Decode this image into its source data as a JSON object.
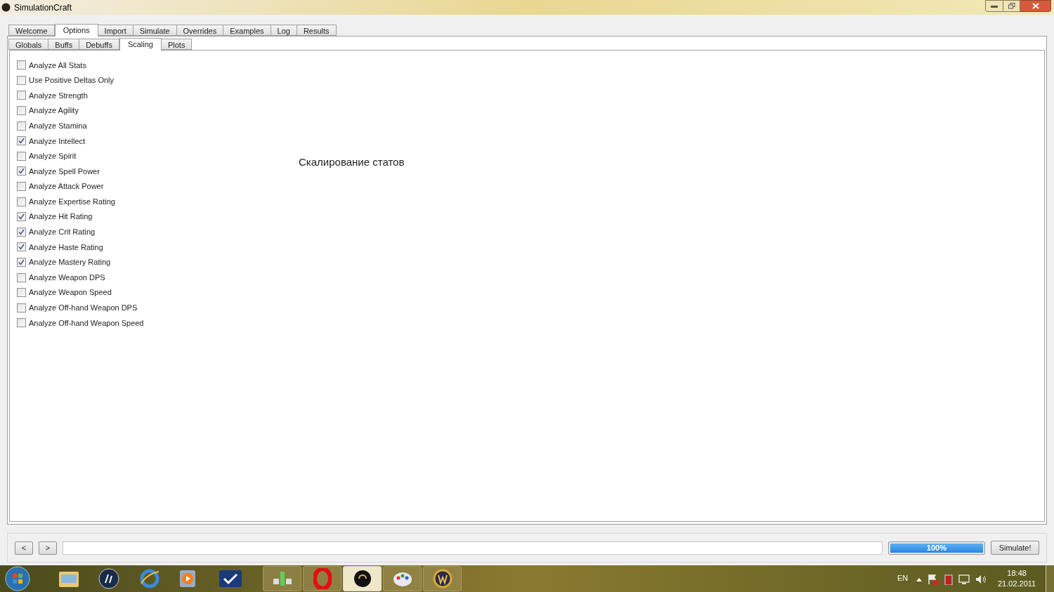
{
  "window": {
    "title": "SimulationCraft"
  },
  "tabs": [
    {
      "label": "Welcome",
      "selected": false
    },
    {
      "label": "Options",
      "selected": true
    },
    {
      "label": "Import",
      "selected": false
    },
    {
      "label": "Simulate",
      "selected": false
    },
    {
      "label": "Overrides",
      "selected": false
    },
    {
      "label": "Examples",
      "selected": false
    },
    {
      "label": "Log",
      "selected": false
    },
    {
      "label": "Results",
      "selected": false
    }
  ],
  "subtabs": [
    {
      "label": "Globals",
      "selected": false
    },
    {
      "label": "Buffs",
      "selected": false
    },
    {
      "label": "Debuffs",
      "selected": false
    },
    {
      "label": "Scaling",
      "selected": true
    },
    {
      "label": "Plots",
      "selected": false
    }
  ],
  "options": [
    {
      "label": "Analyze All Stats",
      "checked": false
    },
    {
      "label": "Use Positive Deltas Only",
      "checked": false
    },
    {
      "label": "Analyze Strength",
      "checked": false
    },
    {
      "label": "Analyze Agility",
      "checked": false
    },
    {
      "label": "Analyze Stamina",
      "checked": false
    },
    {
      "label": "Analyze Intellect",
      "checked": true
    },
    {
      "label": "Analyze Spirit",
      "checked": false
    },
    {
      "label": "Analyze Spell Power",
      "checked": true
    },
    {
      "label": "Analyze Attack Power",
      "checked": false
    },
    {
      "label": "Analyze Expertise Rating",
      "checked": false
    },
    {
      "label": "Analyze Hit Rating",
      "checked": true
    },
    {
      "label": "Analyze Crit Rating",
      "checked": true
    },
    {
      "label": "Analyze Haste Rating",
      "checked": true
    },
    {
      "label": "Analyze Mastery Rating",
      "checked": true
    },
    {
      "label": "Analyze Weapon DPS",
      "checked": false
    },
    {
      "label": "Analyze Weapon Speed",
      "checked": false
    },
    {
      "label": "Analyze Off-hand Weapon DPS",
      "checked": false
    },
    {
      "label": "Analyze Off-hand Weapon Speed",
      "checked": false
    }
  ],
  "caption": "Скалирование статов",
  "bottom_bar": {
    "back": "<",
    "forward": ">",
    "progress": {
      "level": 1,
      "reading": "100%"
    },
    "simulate": "Simulate!"
  },
  "taskbar": {
    "language": "EN",
    "time": "18:48",
    "date": "21.02.2011"
  }
}
